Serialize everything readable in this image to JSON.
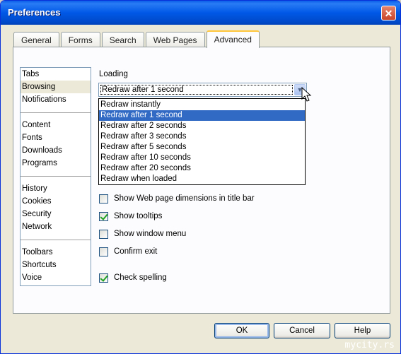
{
  "window": {
    "title": "Preferences",
    "close_label": "✕"
  },
  "tabs": [
    {
      "label": "General"
    },
    {
      "label": "Forms"
    },
    {
      "label": "Search"
    },
    {
      "label": "Web Pages"
    },
    {
      "label": "Advanced",
      "active": true
    }
  ],
  "sidebar": {
    "groups": [
      [
        "Tabs",
        "Browsing",
        "Notifications"
      ],
      [
        "Content",
        "Fonts",
        "Downloads",
        "Programs"
      ],
      [
        "History",
        "Cookies",
        "Security",
        "Network"
      ],
      [
        "Toolbars",
        "Shortcuts",
        "Voice"
      ]
    ],
    "selected": "Browsing"
  },
  "loading": {
    "label": "Loading",
    "selected_value": "Redraw after 1 second",
    "options": [
      "Redraw instantly",
      "Redraw after 1 second",
      "Redraw after 2 seconds",
      "Redraw after 3 seconds",
      "Redraw after 5 seconds",
      "Redraw after 10 seconds",
      "Redraw after 20 seconds",
      "Redraw when loaded"
    ],
    "highlighted_index": 1
  },
  "checkboxes": [
    {
      "label": "Show Web page dimensions in title bar",
      "checked": false
    },
    {
      "label": "Show tooltips",
      "checked": true
    },
    {
      "label": "Show window menu",
      "checked": false
    },
    {
      "label": "Confirm exit",
      "checked": false
    },
    {
      "label": "Check spelling",
      "checked": true
    }
  ],
  "buttons": {
    "ok": "OK",
    "cancel": "Cancel",
    "help": "Help"
  },
  "watermark": "mycity.rs"
}
